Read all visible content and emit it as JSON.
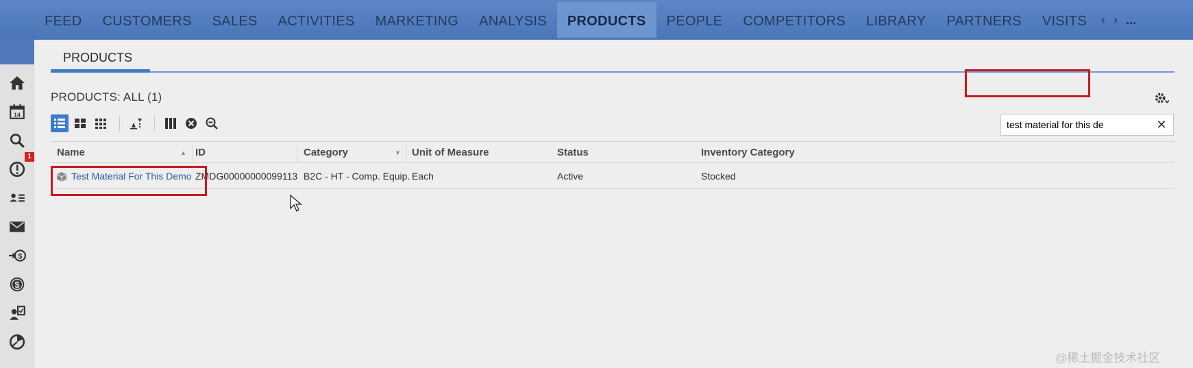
{
  "topnav": {
    "items": [
      {
        "label": "FEED"
      },
      {
        "label": "CUSTOMERS"
      },
      {
        "label": "SALES"
      },
      {
        "label": "ACTIVITIES"
      },
      {
        "label": "MARKETING"
      },
      {
        "label": "ANALYSIS"
      },
      {
        "label": "PRODUCTS",
        "active": true
      },
      {
        "label": "PEOPLE"
      },
      {
        "label": "COMPETITORS"
      },
      {
        "label": "LIBRARY"
      },
      {
        "label": "PARTNERS"
      },
      {
        "label": "VISITS"
      }
    ],
    "prev_arrow": "‹",
    "next_arrow": "›",
    "more": "..."
  },
  "sidebar": {
    "icons": [
      "home-icon",
      "calendar-icon",
      "search-icon",
      "alert-icon",
      "contacts-icon",
      "mail-icon",
      "transfer-dollar-icon",
      "dollar-icon",
      "assign-user-icon",
      "pie-icon"
    ],
    "calendar_day": "14",
    "alert_badge": "1"
  },
  "main": {
    "tab": {
      "label": "PRODUCTS"
    },
    "list_title": "PRODUCTS: ALL (1)",
    "search": {
      "value": "test material for this de",
      "clear": "✕"
    },
    "table": {
      "columns": [
        {
          "label": "Name"
        },
        {
          "label": "ID"
        },
        {
          "label": "Category"
        },
        {
          "label": "Unit of Measure"
        },
        {
          "label": "Status"
        },
        {
          "label": "Inventory Category"
        }
      ],
      "rows": [
        {
          "name": "Test Material For This Demo",
          "id": "ZMDG00000000099113",
          "category": "B2C - HT - Comp. Equip.",
          "unit": "Each",
          "status": "Active",
          "inventory_category": "Stocked"
        }
      ]
    }
  },
  "colors": {
    "nav_bg": "#4a75b8",
    "accent": "#3d7cc9",
    "highlight": "#d0161b",
    "link": "#2b5ea6"
  },
  "watermark": "@稀土掘金技术社区"
}
